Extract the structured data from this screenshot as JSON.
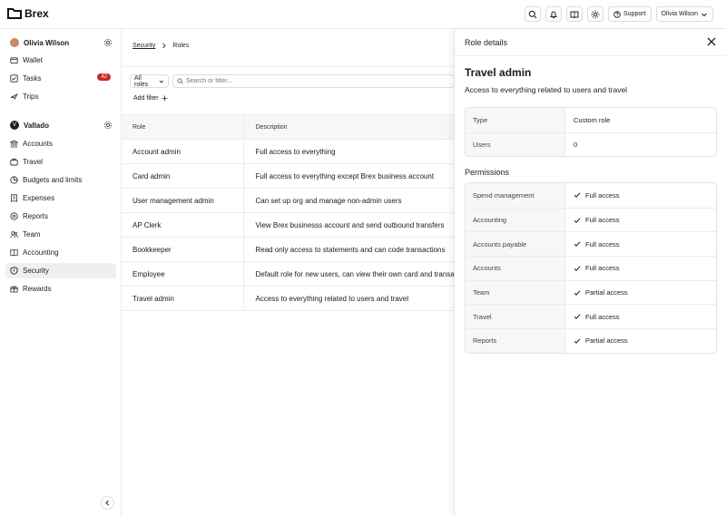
{
  "brand": {
    "name": "Brex"
  },
  "topbar": {
    "support_label": "Support",
    "user_label": "Olivia Wilson"
  },
  "sidebar": {
    "user": {
      "name": "Olivia Wilson"
    },
    "user_items": [
      {
        "label": "Wallet",
        "icon": "wallet-icon"
      },
      {
        "label": "Tasks",
        "icon": "tasks-icon",
        "badge": "42"
      },
      {
        "label": "Trips",
        "icon": "plane-icon"
      }
    ],
    "company": {
      "name": "Vallado",
      "initial": "V"
    },
    "company_items": [
      {
        "label": "Accounts",
        "icon": "bank-icon"
      },
      {
        "label": "Travel",
        "icon": "suitcase-icon"
      },
      {
        "label": "Budgets and limits",
        "icon": "budget-icon"
      },
      {
        "label": "Expenses",
        "icon": "receipt-icon"
      },
      {
        "label": "Reports",
        "icon": "reports-icon"
      },
      {
        "label": "Team",
        "icon": "team-icon"
      },
      {
        "label": "Accounting",
        "icon": "book-icon"
      },
      {
        "label": "Security",
        "icon": "shield-icon",
        "active": true
      },
      {
        "label": "Rewards",
        "icon": "gift-icon"
      }
    ]
  },
  "main": {
    "breadcrumb": {
      "parent": "Security",
      "current": "Roles"
    },
    "filter": {
      "dropdown_label": "All roles",
      "search_placeholder": "Search or filter...",
      "add_filter_label": "Add filter"
    },
    "table": {
      "headers": [
        "Role",
        "Description"
      ],
      "rows": [
        [
          "Account admin",
          "Full access to everything"
        ],
        [
          "Card admin",
          "Full access to everything except Brex business account"
        ],
        [
          "User management admin",
          "Can set up org and manage non-admin users"
        ],
        [
          "AP Clerk",
          "View Brex businesss account and send outbound transfers"
        ],
        [
          "Bookkeeper",
          "Read only access to statements and can code transactions"
        ],
        [
          "Employee",
          "Default role for new users, can view their own card and transactions"
        ],
        [
          "Travel admin",
          "Access to everything related to users and travel"
        ]
      ]
    }
  },
  "panel": {
    "title": "Role details",
    "role_name": "Travel admin",
    "role_description": "Access to everything related to users and travel",
    "details": [
      {
        "key": "Type",
        "value": "Custom role"
      },
      {
        "key": "Users",
        "value": "0"
      }
    ],
    "permissions_title": "Permissions",
    "permissions": [
      {
        "key": "Spend management",
        "value": "Full access"
      },
      {
        "key": "Accounting",
        "value": "Full access"
      },
      {
        "key": "Accounts payable",
        "value": "Full access"
      },
      {
        "key": "Accounts",
        "value": "Full access"
      },
      {
        "key": "Team",
        "value": "Partial access"
      },
      {
        "key": "Travel",
        "value": "Full access"
      },
      {
        "key": "Reports",
        "value": "Partial access"
      }
    ]
  }
}
